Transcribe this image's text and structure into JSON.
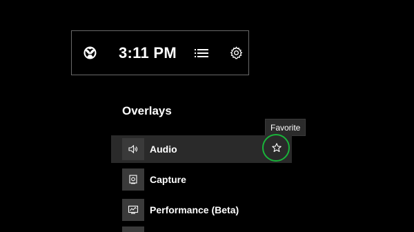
{
  "topbar": {
    "logo_icon": "xbox-logo-icon",
    "time": "3:11 PM",
    "menu_icon": "list-icon",
    "settings_icon": "gear-icon"
  },
  "overlays": {
    "title": "Overlays",
    "tooltip": "Favorite",
    "items": [
      {
        "label": "Audio",
        "icon": "speaker-icon",
        "selected": true
      },
      {
        "label": "Capture",
        "icon": "capture-icon",
        "selected": false
      },
      {
        "label": "Performance (Beta)",
        "icon": "performance-icon",
        "selected": false
      }
    ],
    "favorite_icon": "star-outline-icon",
    "highlight_color": "#19b43a"
  }
}
